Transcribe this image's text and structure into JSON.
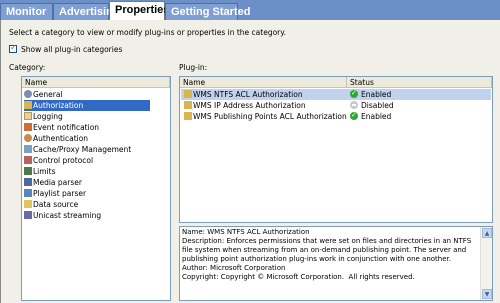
{
  "tabs": [
    {
      "label": "Monitor"
    },
    {
      "label": "Advertising"
    },
    {
      "label": "Properties"
    },
    {
      "label": "Getting Started"
    }
  ],
  "instruction": "Select a category to view or modify plug-ins or properties in the category.",
  "show_all": {
    "label": "Show all plug-in categories",
    "checked": true
  },
  "category": {
    "label": "Category:",
    "column": "Name",
    "items": [
      {
        "label": "General",
        "icon": "gear-icon"
      },
      {
        "label": "Authorization",
        "icon": "key-icon"
      },
      {
        "label": "Logging",
        "icon": "log-icon"
      },
      {
        "label": "Event notification",
        "icon": "event-icon"
      },
      {
        "label": "Authentication",
        "icon": "users-icon"
      },
      {
        "label": "Cache/Proxy Management",
        "icon": "cache-icon"
      },
      {
        "label": "Control protocol",
        "icon": "protocol-icon"
      },
      {
        "label": "Limits",
        "icon": "limits-icon"
      },
      {
        "label": "Media parser",
        "icon": "media-icon"
      },
      {
        "label": "Playlist parser",
        "icon": "playlist-icon"
      },
      {
        "label": "Data source",
        "icon": "folder-icon"
      },
      {
        "label": "Unicast streaming",
        "icon": "unicast-icon"
      }
    ],
    "selected": "Authorization"
  },
  "plugins": {
    "label": "Plug-in:",
    "col_name": "Name",
    "col_status": "Status",
    "rows": [
      {
        "name": "WMS NTFS ACL Authorization",
        "status": "Enabled"
      },
      {
        "name": "WMS IP Address Authorization",
        "status": "Disabled"
      },
      {
        "name": "WMS Publishing Points ACL Authorization",
        "status": "Enabled"
      }
    ]
  },
  "description": {
    "name": "Name: WMS NTFS ACL Authorization",
    "desc": "Description: Enforces permissions that were set on files and directories in an NTFS file system when streaming from an on-demand publishing point. The server and publishing point authorization plug-ins work in conjunction with one another.",
    "author": "Author: Microsoft Corporation",
    "copyright": "Copyright: Copyright © Microsoft Corporation.  All rights reserved."
  },
  "colors": {
    "tab_bar": "#6d8fc7",
    "selection": "#316ac5",
    "enabled": "#2fa52f"
  }
}
